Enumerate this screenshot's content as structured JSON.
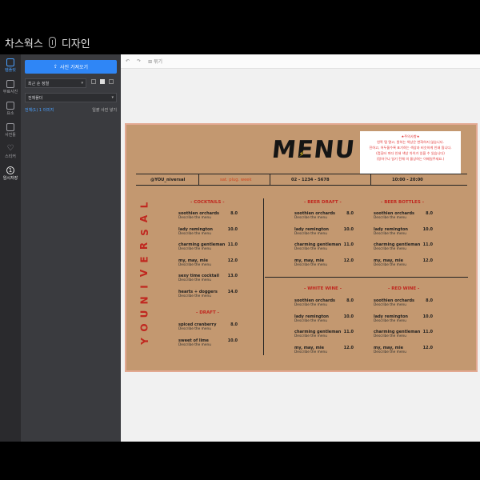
{
  "app": {
    "name_left": "차스웍스",
    "name_right": "디자인"
  },
  "rail": [
    {
      "label": "템플릿",
      "icon": "template-icon"
    },
    {
      "label": "무료사진",
      "icon": "photo-icon"
    },
    {
      "label": "요소",
      "icon": "elements-icon"
    },
    {
      "label": "사진틀",
      "icon": "frame-icon"
    },
    {
      "label": "스티커",
      "icon": "heart-icon"
    },
    {
      "label": "임시저장",
      "icon": "temp-save-icon",
      "glyph": "1"
    }
  ],
  "panel": {
    "upload_label": "사진 가져오기",
    "sort_select": "최근 순 정렬",
    "folder_select": "전체폴더",
    "count_text": "전체(1) 1 이미지",
    "multi_select_label": "일괄 사진 넣기"
  },
  "toolbar": {
    "undo": "↶",
    "redo": "↷",
    "group_label": "묶기"
  },
  "menu": {
    "title": "MENU",
    "notice": [
      "★주의사항★",
      "왼쪽 탭 열고, 원하는 색상은 변화하지 않습니다.",
      "진하고, 어두울수록 표기하는 색상과 비슷하게 인쇄 됩니다.",
      "(컴퓨터 마다 인쇄 색상 차이가 있을 수 있습니다)",
      "",
      "(정하구나 일기 전체 의 물상하는 이메일주세요.)"
    ],
    "handle": "@YOU_niversal",
    "hours_note": "sat. plug. week",
    "phone": "02 - 1234 - 5678",
    "hours": "10:00 - 20:00",
    "brand": "YOUNIVERSAL",
    "desc": "Describe the menu",
    "cocktails": {
      "title": "- COCKTAILS -",
      "items": [
        {
          "name": "soothien orchards",
          "price": "8.0"
        },
        {
          "name": "lady remington",
          "price": "10.0"
        },
        {
          "name": "charming gentleman",
          "price": "11.0"
        },
        {
          "name": "my, may, mie",
          "price": "12.0"
        },
        {
          "name": "sexy time cocktail",
          "price": "13.0"
        },
        {
          "name": "hearts + doggers",
          "price": "14.0"
        }
      ]
    },
    "draft": {
      "title": "- DRAFT -",
      "items": [
        {
          "name": "spiced cranberry",
          "price": "8.0"
        },
        {
          "name": "sweet of lime",
          "price": "10.0"
        }
      ]
    },
    "beer_draft": {
      "title": "- BEER DRAFT -",
      "items": [
        {
          "name": "soothien orchards",
          "price": "8.0"
        },
        {
          "name": "lady remington",
          "price": "10.0"
        },
        {
          "name": "charming gentleman",
          "price": "11.0"
        },
        {
          "name": "my, may, mie",
          "price": "12.0"
        }
      ]
    },
    "beer_bottles": {
      "title": "- BEER BOTTLES -",
      "items": [
        {
          "name": "soothien orchards",
          "price": "8.0"
        },
        {
          "name": "lady remington",
          "price": "10.0"
        },
        {
          "name": "charming gentleman",
          "price": "11.0"
        },
        {
          "name": "my, may, mie",
          "price": "12.0"
        }
      ]
    },
    "white_wine": {
      "title": "- WHITE WINE -",
      "items": [
        {
          "name": "soothien orchards",
          "price": "8.0"
        },
        {
          "name": "lady remington",
          "price": "10.0"
        },
        {
          "name": "charming gentleman",
          "price": "11.0"
        },
        {
          "name": "my, may, mie",
          "price": "12.0"
        }
      ]
    },
    "red_wine": {
      "title": "- RED WINE -",
      "items": [
        {
          "name": "soothien orchards",
          "price": "8.0"
        },
        {
          "name": "lady remington",
          "price": "10.0"
        },
        {
          "name": "charming gentleman",
          "price": "11.0"
        },
        {
          "name": "my, may, mie",
          "price": "12.0"
        }
      ]
    }
  }
}
